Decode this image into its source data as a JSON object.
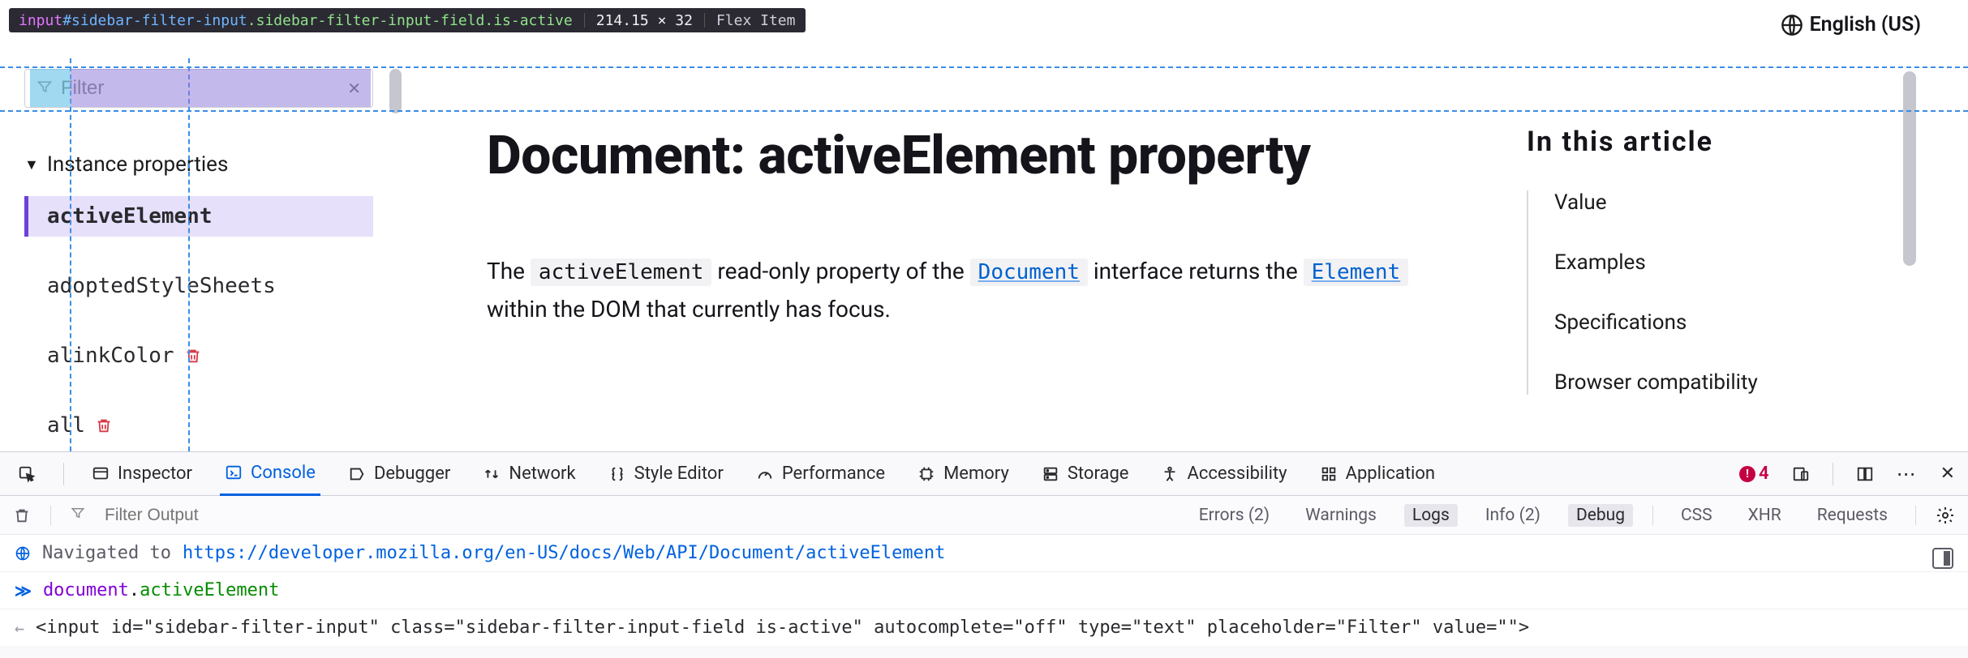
{
  "lang": {
    "label": "English (US)"
  },
  "inspector_tooltip": {
    "tag": "input",
    "id": "#sidebar-filter-input",
    "classes": ".sidebar-filter-input-field.is-active",
    "dimensions": "214.15 × 32",
    "layout": "Flex Item"
  },
  "sidebar": {
    "filter_placeholder": "Filter",
    "section_heading": "Instance properties",
    "items": [
      {
        "label": "activeElement",
        "deprecated": false,
        "active": true
      },
      {
        "label": "adoptedStyleSheets",
        "deprecated": false,
        "active": false
      },
      {
        "label": "alinkColor",
        "deprecated": true,
        "active": false
      },
      {
        "label": "all",
        "deprecated": true,
        "active": false
      }
    ]
  },
  "article": {
    "title": "Document: activeElement property",
    "p_start": "The ",
    "code1": "activeElement",
    "p_mid1": " read-only property of the ",
    "link1": "Document",
    "p_mid2": " interface returns the ",
    "link2": "Element",
    "p_end": " within the DOM that currently has focus."
  },
  "toc": {
    "title": "In this article",
    "items": [
      "Value",
      "Examples",
      "Specifications",
      "Browser compatibility"
    ]
  },
  "devtools": {
    "tabs": [
      "Inspector",
      "Console",
      "Debugger",
      "Network",
      "Style Editor",
      "Performance",
      "Memory",
      "Storage",
      "Accessibility",
      "Application"
    ],
    "active_tab": "Console",
    "error_count": "4",
    "filter_placeholder": "Filter Output",
    "toggles": {
      "errors": {
        "label": "Errors",
        "count": "(2)"
      },
      "warnings": {
        "label": "Warnings",
        "count": ""
      },
      "logs": {
        "label": "Logs",
        "count": ""
      },
      "info": {
        "label": "Info",
        "count": "(2)"
      },
      "debug": {
        "label": "Debug",
        "count": ""
      },
      "css": "CSS",
      "xhr": "XHR",
      "requests": "Requests"
    },
    "nav_prefix": "Navigated to ",
    "nav_url": "https://developer.mozilla.org/en-US/docs/Web/API/Document/activeElement",
    "input_obj": "document",
    "input_dot": ".",
    "input_prop": "activeElement",
    "output_html": "<input id=\"sidebar-filter-input\" class=\"sidebar-filter-input-field is-active\" autocomplete=\"off\" type=\"text\" placeholder=\"Filter\" value=\"\">"
  }
}
